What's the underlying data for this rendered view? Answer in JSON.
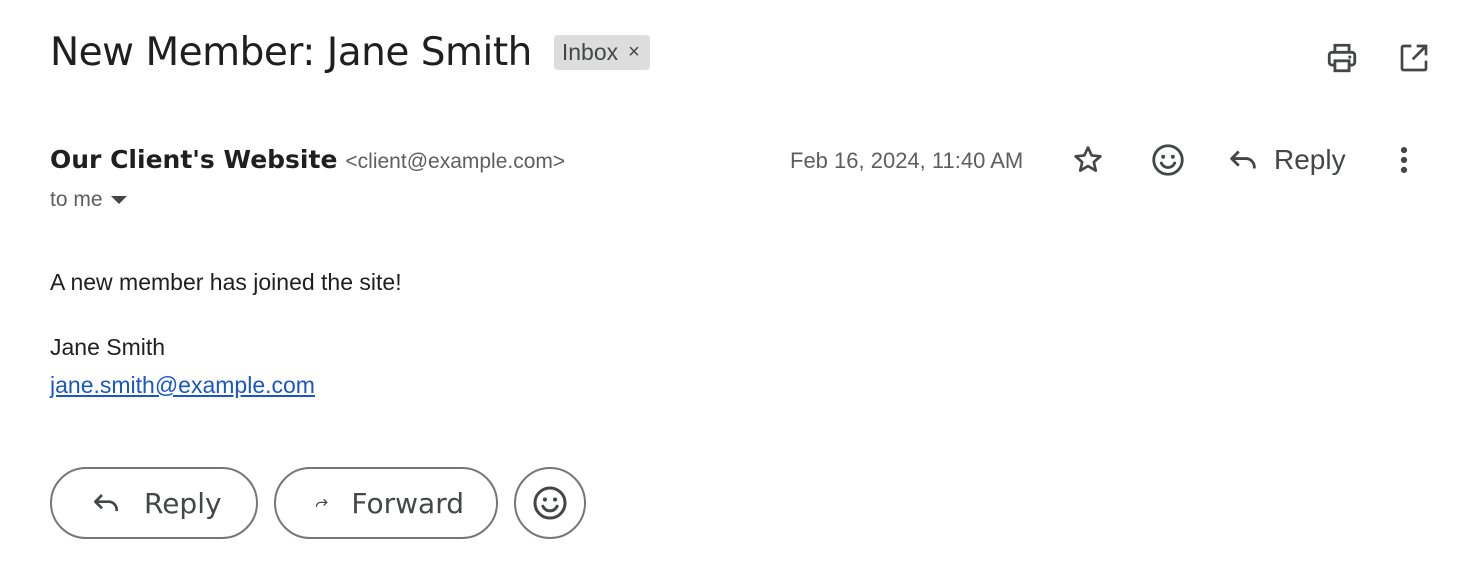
{
  "subject": {
    "title": "New Member: Jane Smith",
    "label": "Inbox",
    "label_remove_glyph": "×"
  },
  "header": {
    "sender_name": "Our Client's Website",
    "sender_email": "<client@example.com>",
    "recipient": "to me",
    "date": "Feb 16, 2024, 11:40 AM",
    "reply_label": "Reply"
  },
  "body": {
    "intro": "A new member has joined the site!",
    "member_name": "Jane Smith",
    "member_email": "jane.smith@example.com"
  },
  "actions": {
    "reply_label": "Reply",
    "forward_label": "Forward"
  },
  "icons": {
    "print": "print-icon",
    "open_new_window": "open-in-new-window-icon",
    "star": "star-icon",
    "emoji": "emoji-icon",
    "reply": "reply-arrow-icon",
    "forward": "forward-arrow-icon",
    "more": "more-vertical-icon"
  },
  "colors": {
    "link": "#1a57c5",
    "text": "#1f1f1f",
    "muted": "#5e5e5e",
    "chip_bg": "#dddddd"
  }
}
